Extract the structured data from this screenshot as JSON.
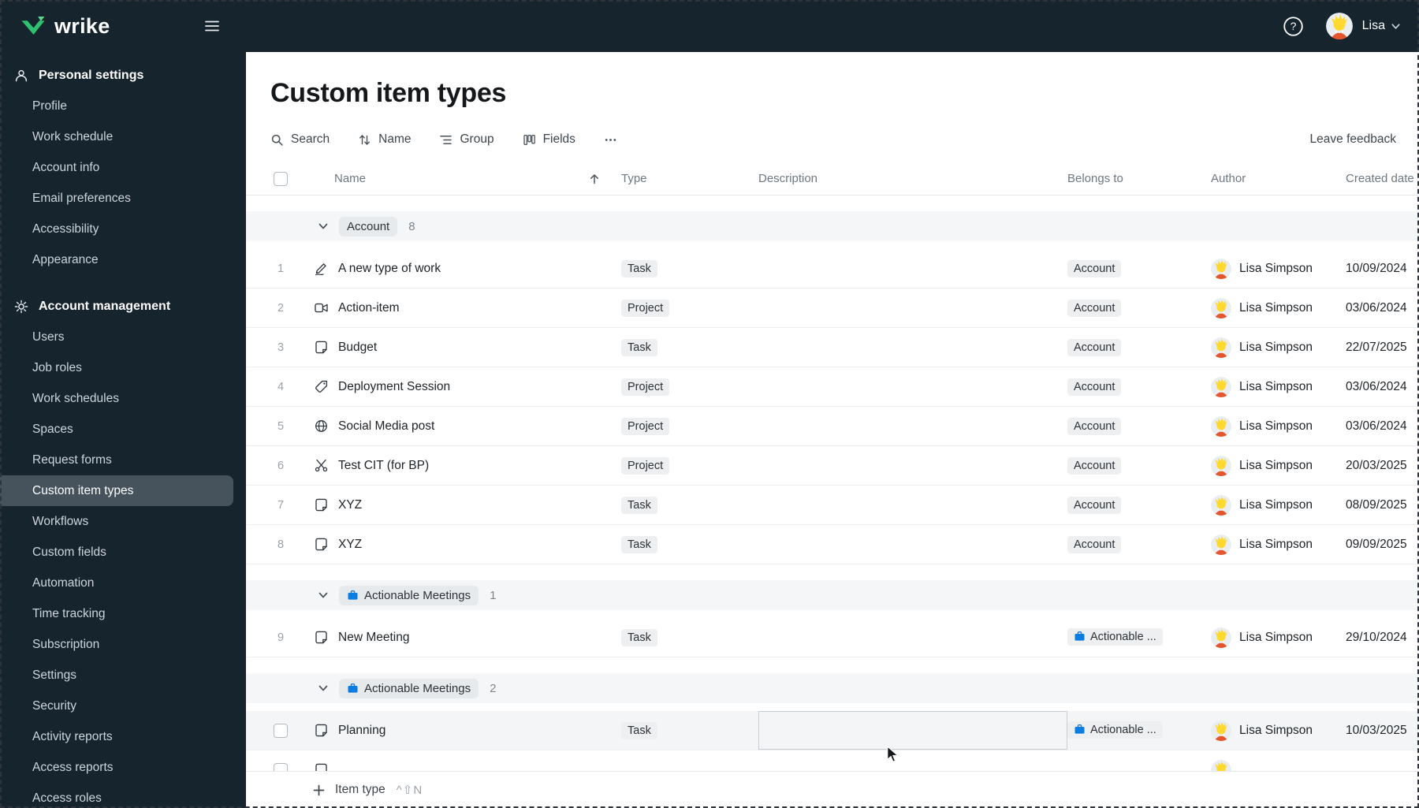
{
  "topbar": {
    "brand": "wrike",
    "user_name": "Lisa"
  },
  "sidebar": {
    "sections": [
      {
        "label": "Personal settings",
        "icon": "person-icon",
        "items": [
          {
            "label": "Profile"
          },
          {
            "label": "Work schedule"
          },
          {
            "label": "Account info"
          },
          {
            "label": "Email preferences"
          },
          {
            "label": "Accessibility"
          },
          {
            "label": "Appearance"
          }
        ]
      },
      {
        "label": "Account management",
        "icon": "gear-icon",
        "items": [
          {
            "label": "Users"
          },
          {
            "label": "Job roles"
          },
          {
            "label": "Work schedules"
          },
          {
            "label": "Spaces"
          },
          {
            "label": "Request forms"
          },
          {
            "label": "Custom item types",
            "selected": true
          },
          {
            "label": "Workflows"
          },
          {
            "label": "Custom fields"
          },
          {
            "label": "Automation"
          },
          {
            "label": "Time tracking"
          },
          {
            "label": "Subscription"
          },
          {
            "label": "Settings"
          },
          {
            "label": "Security"
          },
          {
            "label": "Activity reports"
          },
          {
            "label": "Access reports"
          },
          {
            "label": "Access roles"
          }
        ]
      }
    ]
  },
  "main": {
    "title": "Custom item types",
    "toolbar": {
      "search": "Search",
      "sort": "Name",
      "group": "Group",
      "fields": "Fields",
      "leave_feedback": "Leave feedback"
    },
    "columns": {
      "name": "Name",
      "type": "Type",
      "description": "Description",
      "belongs_to": "Belongs to",
      "author": "Author",
      "created": "Created date"
    },
    "groups": [
      {
        "label": "Account",
        "count": "8",
        "rows": [
          {
            "num": "1",
            "icon": "signature-icon",
            "name": "A new type of work",
            "type": "Task",
            "belongs": "Account",
            "author": "Lisa Simpson",
            "created": "10/09/2024"
          },
          {
            "num": "2",
            "icon": "camera-icon",
            "name": "Action-item",
            "type": "Project",
            "belongs": "Account",
            "author": "Lisa Simpson",
            "created": "03/06/2024"
          },
          {
            "num": "3",
            "icon": "file-icon",
            "name": "Budget",
            "type": "Task",
            "belongs": "Account",
            "author": "Lisa Simpson",
            "created": "22/07/2025"
          },
          {
            "num": "4",
            "icon": "tag-icon",
            "name": "Deployment Session",
            "type": "Project",
            "belongs": "Account",
            "author": "Lisa Simpson",
            "created": "03/06/2024"
          },
          {
            "num": "5",
            "icon": "globe-icon",
            "name": "Social Media post",
            "type": "Project",
            "belongs": "Account",
            "author": "Lisa Simpson",
            "created": "03/06/2024"
          },
          {
            "num": "6",
            "icon": "scissors-icon",
            "name": "Test CIT (for BP)",
            "type": "Project",
            "belongs": "Account",
            "author": "Lisa Simpson",
            "created": "20/03/2025"
          },
          {
            "num": "7",
            "icon": "file-icon",
            "name": "XYZ",
            "type": "Task",
            "belongs": "Account",
            "author": "Lisa Simpson",
            "created": "08/09/2025"
          },
          {
            "num": "8",
            "icon": "file-icon",
            "name": "XYZ",
            "type": "Task",
            "belongs": "Account",
            "author": "Lisa Simpson",
            "created": "09/09/2025"
          }
        ]
      },
      {
        "label": "Actionable Meetings",
        "count": "1",
        "icon": "briefcase-icon",
        "rows": [
          {
            "num": "9",
            "icon": "file-icon",
            "name": "New Meeting",
            "type": "Task",
            "belongs": "Actionable ...",
            "belongs_icon": "briefcase-icon",
            "author": "Lisa Simpson",
            "created": "29/10/2024"
          }
        ]
      },
      {
        "label": "Actionable Meetings",
        "count": "2",
        "icon": "briefcase-icon",
        "rows": [
          {
            "icon": "file-icon",
            "name": "Planning",
            "type": "Task",
            "belongs": "Actionable ...",
            "belongs_icon": "briefcase-icon",
            "author": "Lisa Simpson",
            "created": "10/03/2025",
            "checkbox": true,
            "hover": true,
            "desc_outlined": true
          },
          {
            "icon": "file-icon",
            "clipped": true,
            "checkbox": true
          }
        ]
      }
    ],
    "footer": {
      "add_label": "Item type",
      "shortcut": "^⇧N"
    }
  }
}
